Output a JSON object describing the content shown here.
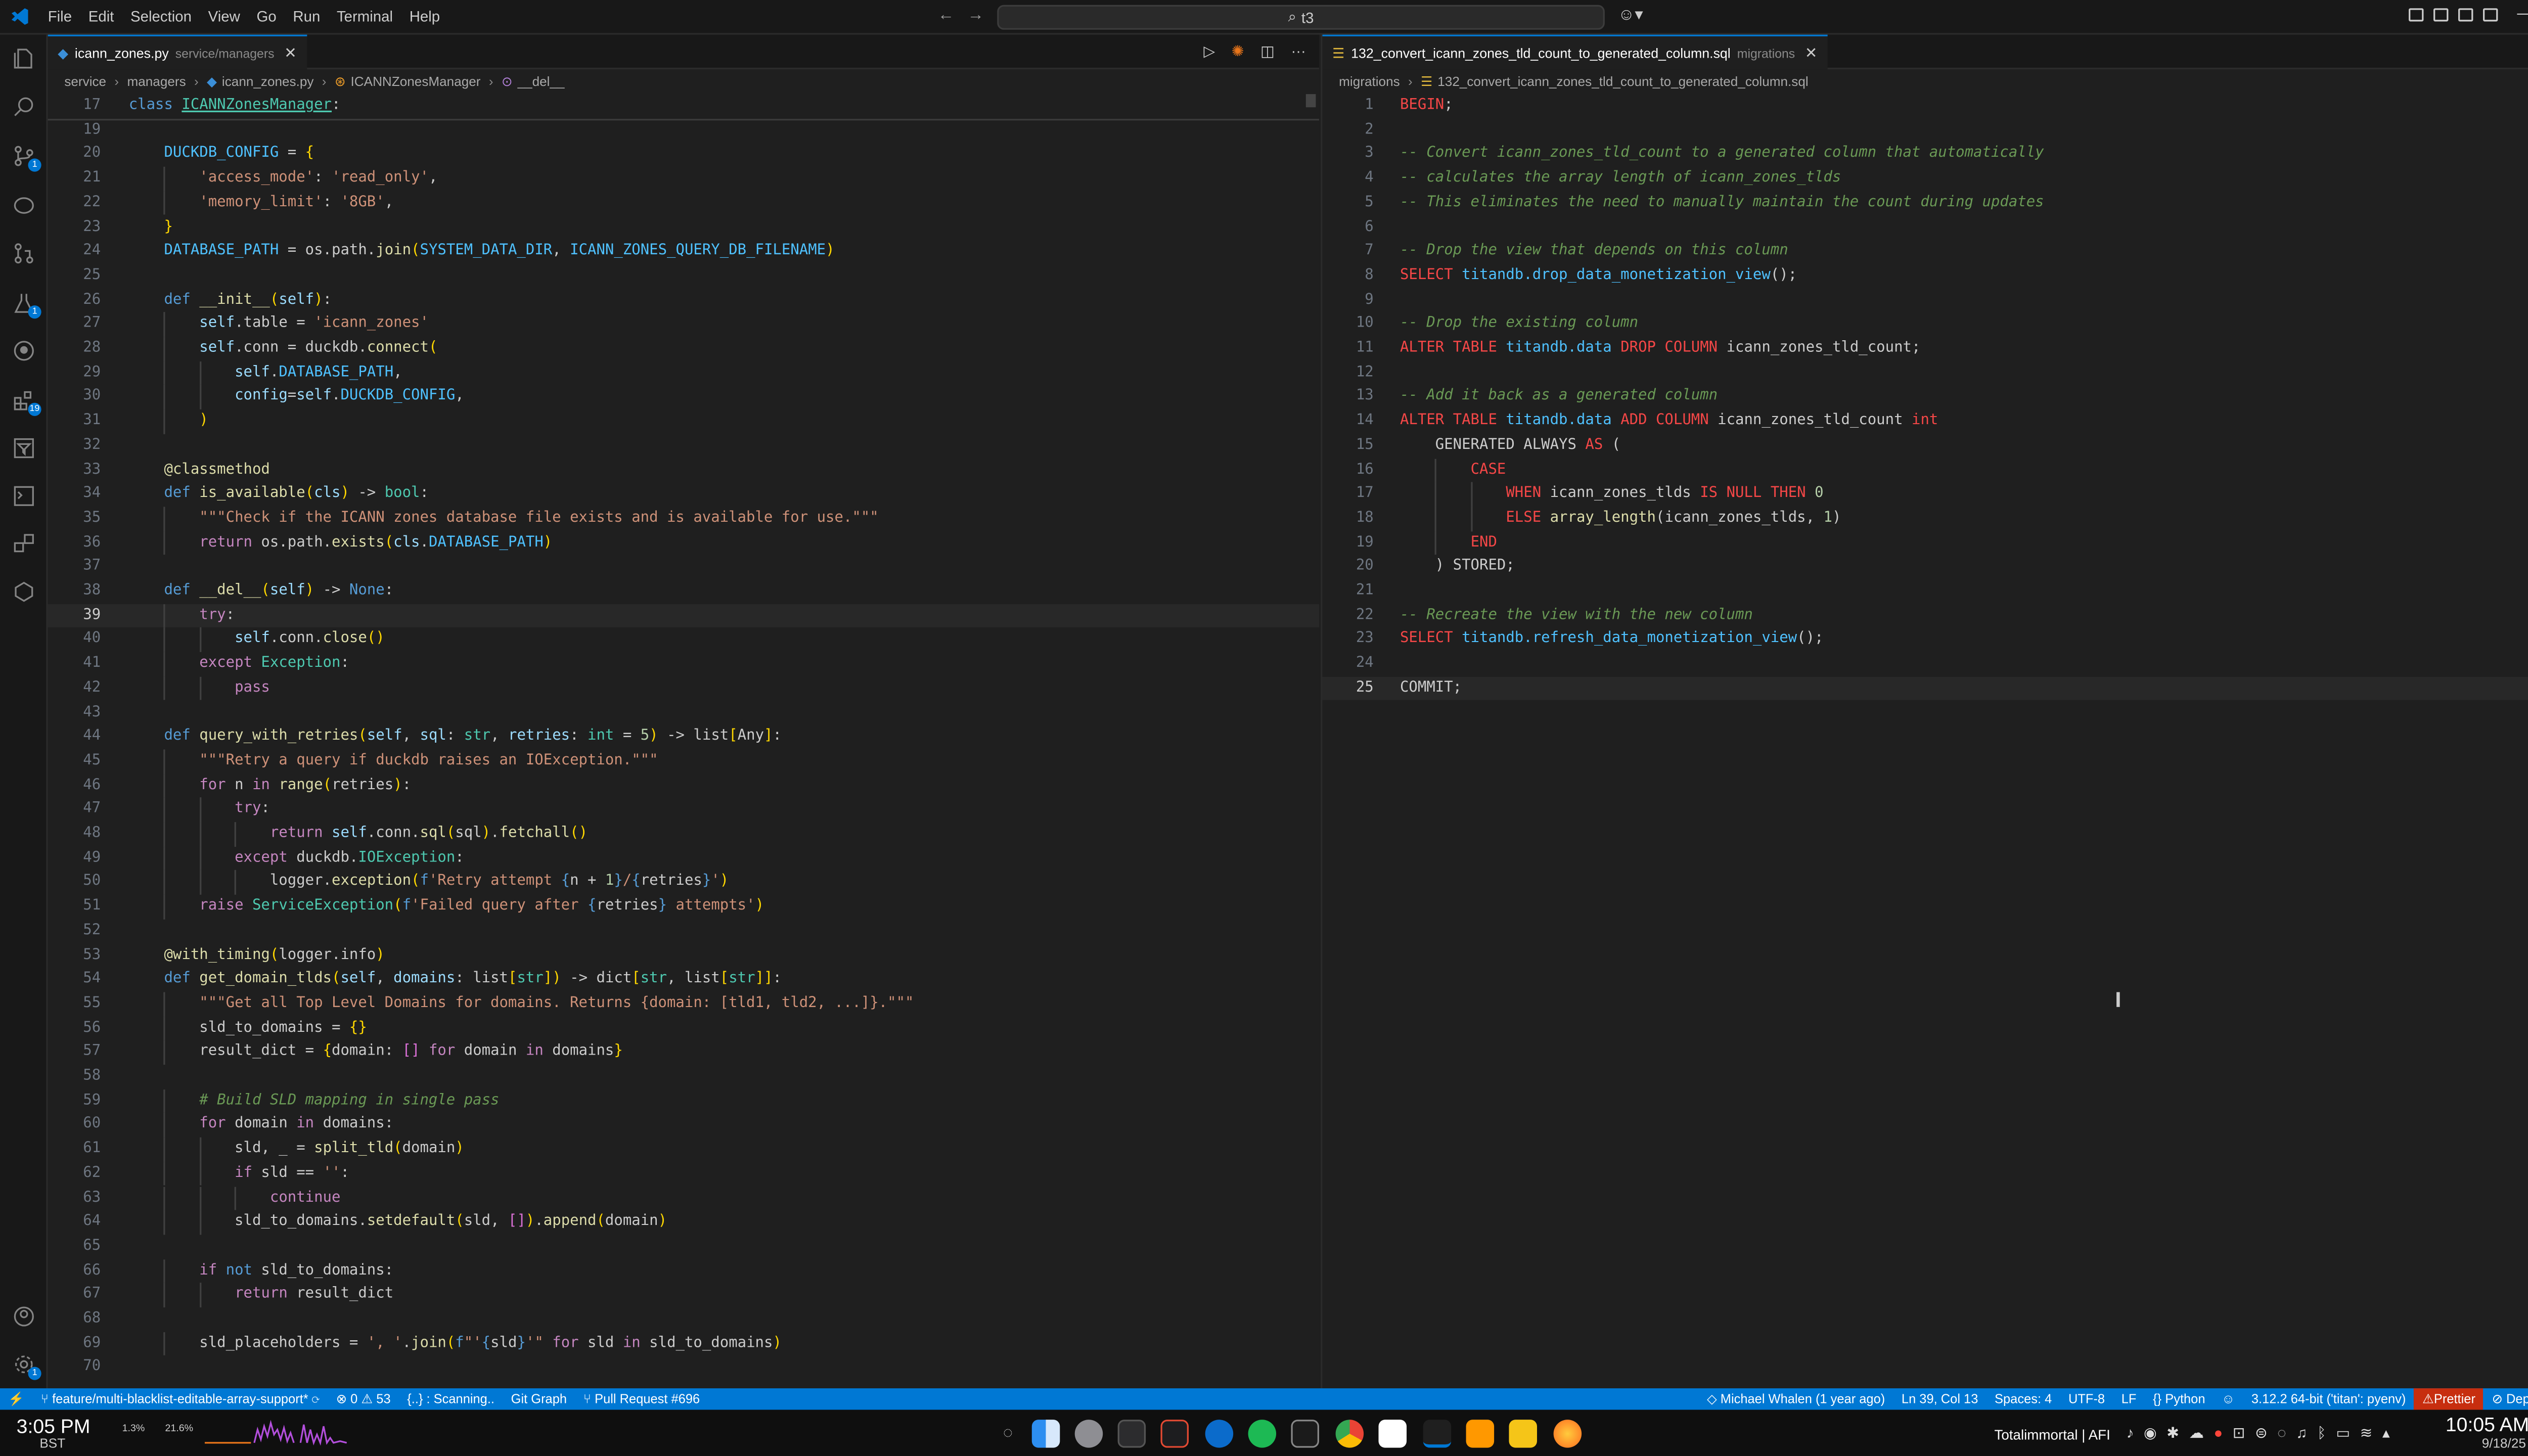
{
  "titlebar": {
    "menu": [
      "File",
      "Edit",
      "Selection",
      "View",
      "Go",
      "Run",
      "Terminal",
      "Help"
    ],
    "search": "t3"
  },
  "activity_badges": {
    "scm": "1",
    "testing": "1",
    "extensions": "19",
    "accounts": "1"
  },
  "left_editor": {
    "tab_name": "icann_zones.py",
    "tab_path": "service/managers",
    "breadcrumb": [
      "service",
      "managers",
      "icann_zones.py",
      "ICANNZonesManager",
      "__del__"
    ],
    "sticky_line_no": "17",
    "current_line": "39"
  },
  "right_editor": {
    "tab_name": "132_convert_icann_zones_tld_count_to_generated_column.sql",
    "tab_path": "migrations",
    "breadcrumb": [
      "migrations",
      "132_convert_icann_zones_tld_count_to_generated_column.sql"
    ]
  },
  "statusbar": {
    "branch": "feature/multi-blacklist-editable-array-support*",
    "problems": "0 ⚠ 53",
    "scanning": "{..} : Scanning..",
    "git_graph": "Git Graph",
    "pull_request": "Pull Request #696",
    "blame": "Michael Whalen (1 year ago)",
    "cursor": "Ln 39, Col 13",
    "spaces": "Spaces: 4",
    "encoding": "UTF-8",
    "eol": "LF",
    "language": "Python",
    "interpreter": "3.12.2 64-bit ('titan': pyenv)",
    "prettier": "Prettier",
    "dependi": "Dependi"
  },
  "dock": {
    "left_time": "3:05 PM",
    "left_tz": "BST",
    "cpu": "1.3%",
    "mem": "21.6%",
    "right_label": "Totalimmortal | AFI",
    "right_time": "10:05 AM",
    "right_date": "9/18/25"
  },
  "python_code": [
    {
      "n": "17",
      "h": "<span class=\"k\">class</span> <span class=\"t\" style=\"text-decoration:underline\">ICANNZonesManager</span>:",
      "x": 0,
      "sticky": true
    },
    {
      "n": "19",
      "h": "",
      "x": 0
    },
    {
      "n": "20",
      "h": "    <span class=\"co\">DUCKDB_CONFIG</span> = <span class=\"y\">{</span>",
      "x": 0
    },
    {
      "n": "21",
      "h": "        <span class=\"s\">'access_mode'</span>: <span class=\"s\">'read_only'</span>,",
      "x": 0
    },
    {
      "n": "22",
      "h": "        <span class=\"s\">'memory_limit'</span>: <span class=\"s\">'8GB'</span>,",
      "x": 0
    },
    {
      "n": "23",
      "h": "    <span class=\"y\">}</span>",
      "x": 0
    },
    {
      "n": "24",
      "h": "    <span class=\"co\">DATABASE_PATH</span> = os.path.<span class=\"f\">join</span><span class=\"y\">(</span><span class=\"co\">SYSTEM_DATA_DIR</span>, <span class=\"co\">ICANN_ZONES_QUERY_DB_FILENAME</span><span class=\"y\">)</span>",
      "x": 0
    },
    {
      "n": "25",
      "h": "",
      "x": 0
    },
    {
      "n": "26",
      "h": "    <span class=\"k\">def</span> <span class=\"f\">__init__</span><span class=\"y\">(</span><span class=\"v\">self</span><span class=\"y\">)</span>:",
      "x": 0
    },
    {
      "n": "27",
      "h": "        <span class=\"v\">self</span>.table = <span class=\"s\">'icann_zones'</span>",
      "x": 0
    },
    {
      "n": "28",
      "h": "        <span class=\"v\">self</span>.conn = duckdb.<span class=\"f\">connect</span><span class=\"y\">(</span>",
      "x": 0
    },
    {
      "n": "29",
      "h": "            <span class=\"v\">self</span>.<span class=\"co\">DATABASE_PATH</span>,",
      "x": 0
    },
    {
      "n": "30",
      "h": "            <span class=\"v\">config</span>=<span class=\"v\">self</span>.<span class=\"co\">DUCKDB_CONFIG</span>,",
      "x": 0
    },
    {
      "n": "31",
      "h": "        <span class=\"y\">)</span>",
      "x": 0
    },
    {
      "n": "32",
      "h": "",
      "x": 0
    },
    {
      "n": "33",
      "h": "    <span class=\"d\">@classmethod</span>",
      "x": 0
    },
    {
      "n": "34",
      "h": "    <span class=\"k\">def</span> <span class=\"f\">is_available</span><span class=\"y\">(</span><span class=\"v\">cls</span><span class=\"y\">)</span> -> <span class=\"t\">bool</span>:",
      "x": 0
    },
    {
      "n": "35",
      "h": "        <span class=\"s\">\"\"\"Check if the ICANN zones database file exists and is available for use.\"\"\"</span>",
      "x": 0
    },
    {
      "n": "36",
      "h": "        <span class=\"kc\">return</span> os.path.<span class=\"f\">exists</span><span class=\"y\">(</span><span class=\"v\">cls</span>.<span class=\"co\">DATABASE_PATH</span><span class=\"y\">)</span>",
      "x": 0
    },
    {
      "n": "37",
      "h": "",
      "x": 0
    },
    {
      "n": "38",
      "h": "    <span class=\"k\">def</span> <span class=\"f\">__del__</span><span class=\"y\">(</span><span class=\"v\">self</span><span class=\"y\">)</span> -> <span class=\"k\">None</span>:",
      "x": 0
    },
    {
      "n": "39",
      "h": "        <span class=\"kc\">try</span>:",
      "x": 0,
      "cur": true
    },
    {
      "n": "40",
      "h": "            <span class=\"v\">self</span>.conn.<span class=\"f\">close</span><span class=\"y\">()</span>",
      "x": 0
    },
    {
      "n": "41",
      "h": "        <span class=\"kc\">except</span> <span class=\"t\">Exception</span>:",
      "x": 0
    },
    {
      "n": "42",
      "h": "            <span class=\"kc\">pass</span>",
      "x": 0
    },
    {
      "n": "43",
      "h": "",
      "x": 0
    },
    {
      "n": "44",
      "h": "    <span class=\"k\">def</span> <span class=\"f\">query_with_retries</span><span class=\"y\">(</span><span class=\"v\">self</span>, <span class=\"v\">sql</span>: <span class=\"t\">str</span>, <span class=\"v\">retries</span>: <span class=\"t\">int</span> = <span class=\"n\">5</span><span class=\"y\">)</span> -> list<span class=\"y\">[</span>Any<span class=\"y\">]</span>:",
      "x": 0
    },
    {
      "n": "45",
      "h": "        <span class=\"s\">\"\"\"Retry a query if duckdb raises an IOException.\"\"\"</span>",
      "x": 0
    },
    {
      "n": "46",
      "h": "        <span class=\"kc\">for</span> n <span class=\"kc\">in</span> <span class=\"f\">range</span><span class=\"y\">(</span>retries<span class=\"y\">)</span>:",
      "x": 0
    },
    {
      "n": "47",
      "h": "            <span class=\"kc\">try</span>:",
      "x": 0
    },
    {
      "n": "48",
      "h": "                <span class=\"kc\">return</span> <span class=\"v\">self</span>.conn.<span class=\"f\">sql</span><span class=\"y\">(</span>sql<span class=\"y\">)</span>.<span class=\"f\">fetchall</span><span class=\"y\">()</span>",
      "x": 0
    },
    {
      "n": "49",
      "h": "            <span class=\"kc\">except</span> duckdb.<span class=\"t\">IOException</span>:",
      "x": 0
    },
    {
      "n": "50",
      "h": "                logger.<span class=\"f\">exception</span><span class=\"y\">(</span><span class=\"k\">f</span><span class=\"s\">'Retry attempt </span><span class=\"k\">{</span>n + <span class=\"n\">1</span><span class=\"k\">}</span><span class=\"s\">/</span><span class=\"k\">{</span>retries<span class=\"k\">}</span><span class=\"s\">'</span><span class=\"y\">)</span>",
      "x": 0
    },
    {
      "n": "51",
      "h": "        <span class=\"kc\">raise</span> <span class=\"t\">ServiceException</span><span class=\"y\">(</span><span class=\"k\">f</span><span class=\"s\">'Failed query after </span><span class=\"k\">{</span>retries<span class=\"k\">}</span><span class=\"s\"> attempts'</span><span class=\"y\">)</span>",
      "x": 0
    },
    {
      "n": "52",
      "h": "",
      "x": 0
    },
    {
      "n": "53",
      "h": "    <span class=\"d\">@with_timing</span><span class=\"y\">(</span>logger.info<span class=\"y\">)</span>",
      "x": 0
    },
    {
      "n": "54",
      "h": "    <span class=\"k\">def</span> <span class=\"f\">get_domain_tlds</span><span class=\"y\">(</span><span class=\"v\">self</span>, <span class=\"v\">domains</span>: list<span class=\"y\">[</span><span class=\"t\">str</span><span class=\"y\">]</span><span class=\"y\">)</span> -> dict<span class=\"y\">[</span><span class=\"t\">str</span>, list<span class=\"y\">[</span><span class=\"t\">str</span><span class=\"y\">]]</span>:",
      "x": 0
    },
    {
      "n": "55",
      "h": "        <span class=\"s\">\"\"\"Get all Top Level Domains for domains. Returns {domain: [tld1, tld2, ...]}.\"\"\"</span>",
      "x": 0
    },
    {
      "n": "56",
      "h": "        sld_to_domains = <span class=\"y\">{}</span>",
      "x": 0
    },
    {
      "n": "57",
      "h": "        result_dict = <span class=\"y\">{</span>domain: <span class=\"pk\">[]</span> <span class=\"kc\">for</span> domain <span class=\"kc\">in</span> domains<span class=\"y\">}</span>",
      "x": 0
    },
    {
      "n": "58",
      "h": "",
      "x": 0
    },
    {
      "n": "59",
      "h": "        <span class=\"c\"># Build SLD mapping in single pass</span>",
      "x": 0
    },
    {
      "n": "60",
      "h": "        <span class=\"kc\">for</span> domain <span class=\"kc\">in</span> domains:",
      "x": 0
    },
    {
      "n": "61",
      "h": "            sld, _ = <span class=\"f\">split_tld</span><span class=\"y\">(</span>domain<span class=\"y\">)</span>",
      "x": 0
    },
    {
      "n": "62",
      "h": "            <span class=\"kc\">if</span> sld == <span class=\"s\">''</span>:",
      "x": 0
    },
    {
      "n": "63",
      "h": "                <span class=\"kc\">continue</span>",
      "x": 0
    },
    {
      "n": "64",
      "h": "            sld_to_domains.<span class=\"f\">setdefault</span><span class=\"y\">(</span>sld, <span class=\"pk\">[]</span><span class=\"y\">)</span>.<span class=\"f\">append</span><span class=\"y\">(</span>domain<span class=\"y\">)</span>",
      "x": 0
    },
    {
      "n": "65",
      "h": "",
      "x": 0
    },
    {
      "n": "66",
      "h": "        <span class=\"kc\">if</span> <span class=\"k\">not</span> sld_to_domains:",
      "x": 0
    },
    {
      "n": "67",
      "h": "            <span class=\"kc\">return</span> result_dict",
      "x": 0
    },
    {
      "n": "68",
      "h": "",
      "x": 0
    },
    {
      "n": "69",
      "h": "        sld_placeholders = <span class=\"s\">', '</span>.<span class=\"f\">join</span><span class=\"y\">(</span><span class=\"k\">f</span><span class=\"s\">\"'</span><span class=\"k\">{</span>sld<span class=\"k\">}</span><span class=\"s\">'\"</span> <span class=\"kc\">for</span> sld <span class=\"kc\">in</span> sld_to_domains<span class=\"y\">)</span>",
      "x": 0
    },
    {
      "n": "70",
      "h": "",
      "x": 0
    }
  ],
  "sql_code": [
    {
      "n": "1",
      "h": "<span class=\"sq-kw\">BEGIN</span>;"
    },
    {
      "n": "2",
      "h": ""
    },
    {
      "n": "3",
      "h": "<span class=\"sq-com\">-- Convert icann_zones_tld_count to a generated column that automatically</span>"
    },
    {
      "n": "4",
      "h": "<span class=\"sq-com\">-- calculates the array length of icann_zones_tlds</span>"
    },
    {
      "n": "5",
      "h": "<span class=\"sq-com\">-- This eliminates the need to manually maintain the count during updates</span>"
    },
    {
      "n": "6",
      "h": ""
    },
    {
      "n": "7",
      "h": "<span class=\"sq-com\">-- Drop the view that depends on this column</span>"
    },
    {
      "n": "8",
      "h": "<span class=\"sq-kw\">SELECT</span> <span class=\"sq-f\">titandb.drop_data_monetization_view</span>();"
    },
    {
      "n": "9",
      "h": ""
    },
    {
      "n": "10",
      "h": "<span class=\"sq-com\">-- Drop the existing column</span>"
    },
    {
      "n": "11",
      "h": "<span class=\"sq-kw\">ALTER TABLE</span> <span class=\"sq-f\">titandb.data</span> <span class=\"sq-kw\">DROP COLUMN</span> icann_zones_tld_count;"
    },
    {
      "n": "12",
      "h": ""
    },
    {
      "n": "13",
      "h": "<span class=\"sq-com\">-- Add it back as a generated column</span>"
    },
    {
      "n": "14",
      "h": "<span class=\"sq-kw\">ALTER TABLE</span> <span class=\"sq-f\">titandb.data</span> <span class=\"sq-kw\">ADD COLUMN</span> icann_zones_tld_count <span class=\"sq-kw\">int</span>"
    },
    {
      "n": "15",
      "h": "    GENERATED ALWAYS <span class=\"sq-kw\">AS</span> ("
    },
    {
      "n": "16",
      "h": "        <span class=\"sq-kw\">CASE</span>"
    },
    {
      "n": "17",
      "h": "            <span class=\"sq-kw\">WHEN</span> icann_zones_tlds <span class=\"sq-kw\">IS NULL THEN</span> <span class=\"sq-n\">0</span>"
    },
    {
      "n": "18",
      "h": "            <span class=\"sq-kw\">ELSE</span> <span class=\"f\">array_length</span>(icann_zones_tlds, <span class=\"sq-n\">1</span>)"
    },
    {
      "n": "19",
      "h": "        <span class=\"sq-kw\">END</span>"
    },
    {
      "n": "20",
      "h": "    ) STORED;"
    },
    {
      "n": "21",
      "h": ""
    },
    {
      "n": "22",
      "h": "<span class=\"sq-com\">-- Recreate the view with the new column</span>"
    },
    {
      "n": "23",
      "h": "<span class=\"sq-kw\">SELECT</span> <span class=\"sq-f\">titandb.refresh_data_monetization_view</span>();"
    },
    {
      "n": "24",
      "h": ""
    },
    {
      "n": "25",
      "h": "COMMIT;",
      "cur": true
    }
  ]
}
